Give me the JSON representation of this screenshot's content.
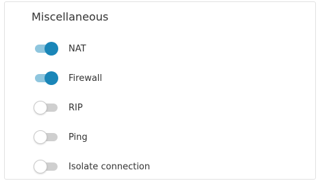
{
  "section": {
    "title": "Miscellaneous"
  },
  "toggles": [
    {
      "label": "NAT",
      "enabled": true
    },
    {
      "label": "Firewall",
      "enabled": true
    },
    {
      "label": "RIP",
      "enabled": false
    },
    {
      "label": "Ping",
      "enabled": false
    },
    {
      "label": "Isolate connection",
      "enabled": false
    }
  ],
  "colors": {
    "toggle_on_knob": "#1a86b8",
    "toggle_on_track": "#8fc6de",
    "toggle_off_track": "#cfcfcf",
    "text": "#333333"
  }
}
